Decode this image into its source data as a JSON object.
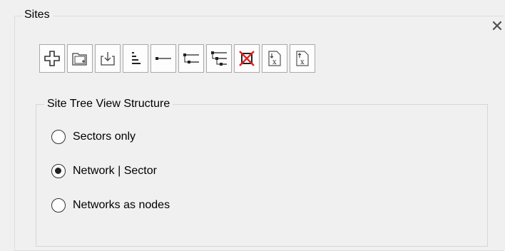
{
  "panel": {
    "title": "Sites",
    "close_symbol": "✕"
  },
  "toolbar": {
    "buttons": [
      {
        "icon": "add-icon"
      },
      {
        "icon": "add-folder-icon"
      },
      {
        "icon": "import-icon"
      },
      {
        "icon": "sort-levels-icon"
      },
      {
        "icon": "single-level-icon"
      },
      {
        "icon": "two-level-icon"
      },
      {
        "icon": "three-level-icon"
      },
      {
        "icon": "delete-red-x-icon"
      },
      {
        "icon": "export-down-icon"
      },
      {
        "icon": "export-up-icon"
      }
    ]
  },
  "structure": {
    "title": "Site Tree View Structure",
    "options": [
      {
        "label": "Sectors only",
        "checked": false
      },
      {
        "label": "Network | Sector",
        "checked": true
      },
      {
        "label": "Networks as nodes",
        "checked": false
      }
    ]
  },
  "colors": {
    "delete_accent": "#e02020",
    "border": "#a9a9a9"
  }
}
